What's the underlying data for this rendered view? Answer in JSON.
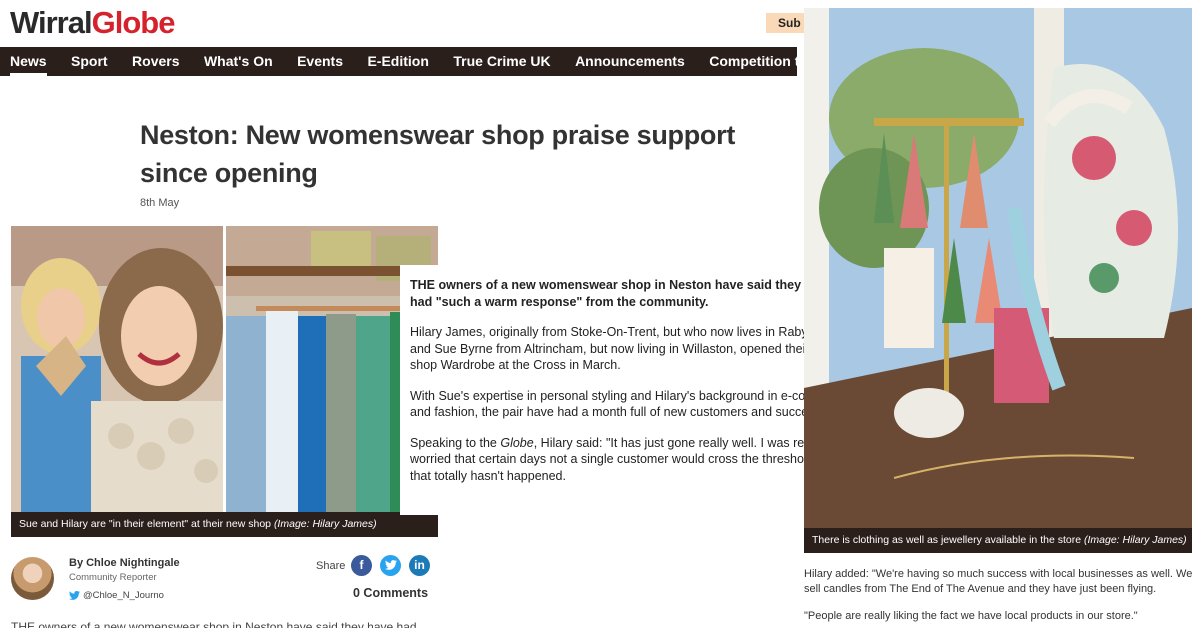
{
  "header": {
    "logo_part1": "Wirral",
    "logo_part2": "Globe",
    "subscribe_label": "Sub"
  },
  "nav": {
    "items": [
      "News",
      "Sport",
      "Rovers",
      "What's On",
      "Events",
      "E-Edition",
      "True Crime UK",
      "Announcements",
      "Competition terms and"
    ]
  },
  "article": {
    "headline": "Neston: New womenswear shop praise support since opening",
    "date": "8th May",
    "photo_caption": "Sue and Hilary are \"in their element\" at their new shop",
    "photo_credit": "(Image: Hilary James)",
    "author": "By Chloe Nightingale",
    "role": "Community Reporter",
    "twitter_handle": "@Chloe_N_Journo",
    "share_label": "Share",
    "comments": "0 Comments",
    "teaser": "THE owners of a new womenswear shop in Neston have said they have had"
  },
  "textbox": {
    "p1": "THE owners of a new womenswear shop in Neston have said they have had \"such a warm response\" from the community.",
    "p2": "Hilary James, originally from Stoke-On-Trent, but who now lives in Raby Mere, and Sue Byrne from Altrincham, but now living in Willaston, opened their new shop Wardrobe at the Cross in March.",
    "p3": "With Sue's expertise in personal styling and Hilary's background in e-commerce and fashion, the pair have had a month full of new customers and success.",
    "p4_pre": "Speaking to the ",
    "p4_em": "Globe",
    "p4_post": ", Hilary said: \"It has just gone really well. I was really worried that certain days not a single customer would cross the threshold and that totally hasn't happened."
  },
  "right": {
    "photo_caption": "There is clothing as well as jewellery available in the store",
    "photo_credit": "(Image: Hilary James)",
    "para1": "Hilary added: \"We're having so much success with local businesses as well. We sell candles from The End of The Avenue and they have just been flying.",
    "para2": "\"People are really liking the fact we have local products in our store.\""
  },
  "icons": {
    "facebook": "facebook-icon",
    "twitter": "twitter-icon",
    "linkedin": "linkedin-icon"
  },
  "colors": {
    "brand_red": "#d4232c",
    "nav_bg": "#2b1f1c",
    "subscribe_bg": "#f9d9b8"
  }
}
